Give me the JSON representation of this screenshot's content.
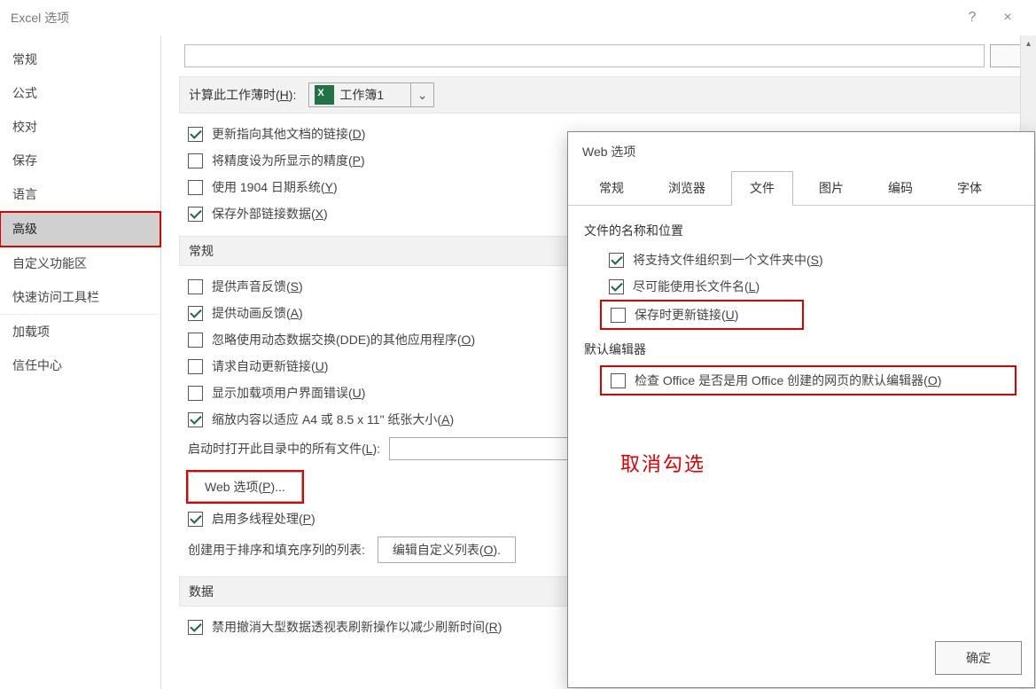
{
  "window": {
    "title": "Excel 选项",
    "help": "?",
    "close": "×"
  },
  "nav": {
    "items": [
      {
        "label": "常规"
      },
      {
        "label": "公式"
      },
      {
        "label": "校对"
      },
      {
        "label": "保存"
      },
      {
        "label": "语言"
      },
      {
        "label": "高级",
        "active": true,
        "highlight": true
      },
      {
        "label": "自定义功能区"
      },
      {
        "label": "快速访问工具栏"
      },
      {
        "label": "加载项"
      },
      {
        "label": "信任中心"
      }
    ]
  },
  "topbar": {
    "button": "     "
  },
  "calc_header": {
    "label_pre": "计算此工作薄时(",
    "label_u": "H",
    "label_post": "):",
    "workbook": "工作簿1"
  },
  "calc_opts": [
    {
      "checked": true,
      "text": "更新指向其他文档的链接(",
      "u": "D",
      "suf": ")"
    },
    {
      "checked": false,
      "text": "将精度设为所显示的精度(",
      "u": "P",
      "suf": ")"
    },
    {
      "checked": false,
      "text": "使用 1904 日期系统(",
      "u": "Y",
      "suf": ")"
    },
    {
      "checked": true,
      "text": "保存外部链接数据(",
      "u": "X",
      "suf": ")"
    }
  ],
  "general_header": "常规",
  "general_opts": [
    {
      "checked": false,
      "text": "提供声音反馈(",
      "u": "S",
      "suf": ")"
    },
    {
      "checked": true,
      "text": "提供动画反馈(",
      "u": "A",
      "suf": ")"
    },
    {
      "checked": false,
      "text": "忽略使用动态数据交换(DDE)的其他应用程序(",
      "u": "O",
      "suf": ")"
    },
    {
      "checked": false,
      "text": "请求自动更新链接(",
      "u": "U",
      "suf": ")"
    },
    {
      "checked": false,
      "text": "显示加载项用户界面错误(",
      "u": "U",
      "suf": ")"
    },
    {
      "checked": true,
      "text": "缩放内容以适应 A4 或 8.5 x 11\" 纸张大小(",
      "u": "A",
      "suf": ")"
    }
  ],
  "startup_label": {
    "pre": "启动时打开此目录中的所有文件(",
    "u": "L",
    "suf": "):"
  },
  "webopt_btn": {
    "pre": "Web 选项(",
    "u": "P",
    "suf": ")..."
  },
  "multithread": {
    "pre": "启用多线程处理(",
    "u": "P",
    "suf": ")"
  },
  "sort_label": "创建用于排序和填充序列的列表:",
  "sort_btn": {
    "pre": "编辑自定义列表(",
    "u": "O",
    "suf": ")."
  },
  "data_header": "数据",
  "data_opt1": {
    "pre": "禁用撤消大型数据透视表刷新操作以减少刷新时间(",
    "u": "R",
    "suf": ")"
  },
  "webdlg": {
    "title": "Web 选项",
    "tabs": [
      "常规",
      "浏览器",
      "文件",
      "图片",
      "编码",
      "字体"
    ],
    "active_tab": 2,
    "grp1_title": "文件的名称和位置",
    "grp1_opts": [
      {
        "checked": true,
        "pre": "将支持文件组织到一个文件夹中(",
        "u": "S",
        "suf": ")"
      },
      {
        "checked": true,
        "pre": "尽可能使用长文件名(",
        "u": "L",
        "suf": ")"
      },
      {
        "checked": false,
        "pre": "保存时更新链接(",
        "u": "U",
        "suf": ")",
        "highlight": true
      }
    ],
    "grp2_title": "默认编辑器",
    "grp2_opt": {
      "checked": false,
      "pre": "检查 Office 是否是用 Office 创建的网页的默认编辑器(",
      "u": "O",
      "suf": ")",
      "highlight": true
    },
    "ok": "确定"
  },
  "annotation": "取消勾选"
}
